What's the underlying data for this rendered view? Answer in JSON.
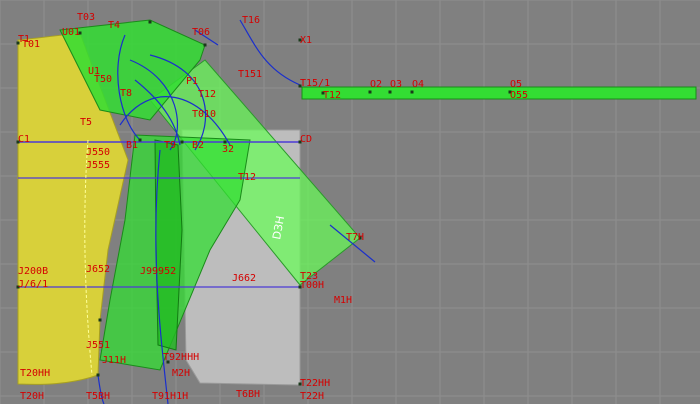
{
  "canvas": {
    "background": "#808080",
    "grid_color": "#8f8f8f",
    "label_color": "#d40000",
    "curve_color": "#1a2fcc",
    "yellow_fill": "#d8d03a",
    "green_fill": "#33dd33",
    "light_green_fill": "#66ff55",
    "gray_fill": "#bdbdbd"
  },
  "labels": [
    {
      "id": "t03",
      "text": "T03"
    },
    {
      "id": "t1",
      "text": "T1"
    },
    {
      "id": "t01",
      "text": "T01"
    },
    {
      "id": "u01",
      "text": "U01"
    },
    {
      "id": "t4",
      "text": "T4"
    },
    {
      "id": "t06",
      "text": "T06"
    },
    {
      "id": "t16",
      "text": "T16"
    },
    {
      "id": "x1",
      "text": "X1"
    },
    {
      "id": "u1",
      "text": "U1"
    },
    {
      "id": "t50",
      "text": "T50"
    },
    {
      "id": "t151",
      "text": "T151"
    },
    {
      "id": "t15",
      "text": "T15/1"
    },
    {
      "id": "t12a",
      "text": "T12"
    },
    {
      "id": "o2",
      "text": "O2"
    },
    {
      "id": "o3",
      "text": "O3"
    },
    {
      "id": "o4",
      "text": "O4"
    },
    {
      "id": "o5",
      "text": "O5"
    },
    {
      "id": "o55",
      "text": "O55"
    },
    {
      "id": "t8",
      "text": "T8"
    },
    {
      "id": "t12b",
      "text": "T12"
    },
    {
      "id": "p1",
      "text": "P1"
    },
    {
      "id": "t5",
      "text": "T5"
    },
    {
      "id": "t010",
      "text": "T010"
    },
    {
      "id": "c1",
      "text": "C1"
    },
    {
      "id": "b1",
      "text": "B1"
    },
    {
      "id": "t9",
      "text": "T9"
    },
    {
      "id": "b2",
      "text": "B2"
    },
    {
      "id": "b32",
      "text": "32"
    },
    {
      "id": "cd",
      "text": "CD"
    },
    {
      "id": "j550",
      "text": "J550"
    },
    {
      "id": "j555",
      "text": "J555"
    },
    {
      "id": "t12c",
      "text": "T12"
    },
    {
      "id": "t7h",
      "text": "T7H"
    },
    {
      "id": "j200b",
      "text": "J200B"
    },
    {
      "id": "j6",
      "text": "J/6/1"
    },
    {
      "id": "j652",
      "text": "J652"
    },
    {
      "id": "j99",
      "text": "J99952"
    },
    {
      "id": "j662",
      "text": "J662"
    },
    {
      "id": "t23",
      "text": "T23"
    },
    {
      "id": "t00h",
      "text": "T00H"
    },
    {
      "id": "m1h",
      "text": "M1H"
    },
    {
      "id": "j551",
      "text": "J551"
    },
    {
      "id": "j11h",
      "text": "J11H"
    },
    {
      "id": "t92",
      "text": "T92HHH"
    },
    {
      "id": "m2h",
      "text": "M2H"
    },
    {
      "id": "t20hh",
      "text": "T20HH"
    },
    {
      "id": "t22hh",
      "text": "T22HH"
    },
    {
      "id": "t20h",
      "text": "T20H"
    },
    {
      "id": "t5bh",
      "text": "T5BH"
    },
    {
      "id": "t91h",
      "text": "T91H1H"
    },
    {
      "id": "t6bh",
      "text": "T6BH"
    },
    {
      "id": "t22h",
      "text": "T22H"
    },
    {
      "id": "rot",
      "text": "DЗН"
    }
  ]
}
